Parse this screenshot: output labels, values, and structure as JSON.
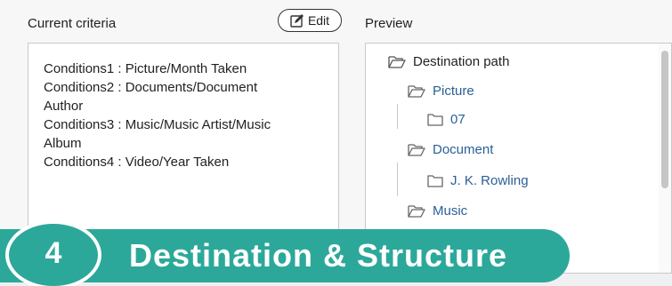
{
  "criteria": {
    "title": "Current criteria",
    "edit_label": "Edit",
    "lines": [
      "Conditions1 : Picture/Month Taken",
      "Conditions2 : Documents/Document",
      "Author",
      "Conditions3 : Music/Music Artist/Music",
      "Album",
      "Conditions4 : Video/Year Taken"
    ]
  },
  "preview": {
    "title": "Preview",
    "root": "Destination path",
    "nodes": [
      "Picture",
      "07",
      "Document",
      "J. K. Rowling",
      "Music"
    ]
  },
  "step_banner": {
    "number": "4",
    "title": "Destination & Structure"
  },
  "colors": {
    "accent": "#2ca89a",
    "node_text": "#2a5f95"
  }
}
